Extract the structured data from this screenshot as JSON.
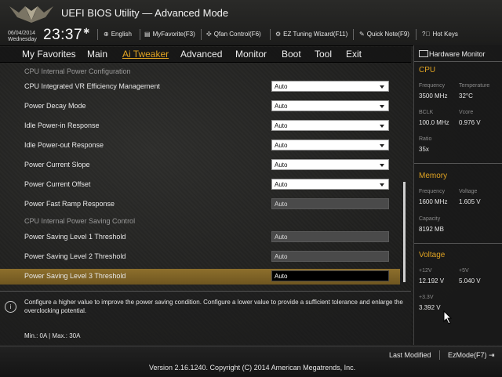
{
  "header": {
    "title": "UEFI BIOS Utility — Advanced Mode",
    "date": "06/04/2014",
    "weekday": "Wednesday",
    "time": "23:37",
    "toolbar": [
      {
        "icon": "globe-icon",
        "label": "English"
      },
      {
        "icon": "favorite-icon",
        "label": "MyFavorite(F3)"
      },
      {
        "icon": "fan-icon",
        "label": "Qfan Control(F6)"
      },
      {
        "icon": "wizard-icon",
        "label": "EZ Tuning Wizard(F11)"
      },
      {
        "icon": "note-icon",
        "label": "Quick Note(F9)"
      },
      {
        "icon": "help-icon",
        "label": "Hot Keys"
      }
    ]
  },
  "menu": {
    "items": [
      "My Favorites",
      "Main",
      "Ai Tweaker",
      "Advanced",
      "Monitor",
      "Boot",
      "Tool",
      "Exit"
    ],
    "active": "Ai Tweaker"
  },
  "settings": [
    {
      "label": "CPU Internal Power Configuration",
      "type": "group"
    },
    {
      "label": "CPU Integrated VR Efficiency Management",
      "value": "Auto",
      "control": "dropdown"
    },
    {
      "label": "Power Decay Mode",
      "value": "Auto",
      "control": "dropdown"
    },
    {
      "label": "Idle Power-in Response",
      "value": "Auto",
      "control": "dropdown"
    },
    {
      "label": "Idle Power-out Response",
      "value": "Auto",
      "control": "dropdown"
    },
    {
      "label": "Power Current Slope",
      "value": "Auto",
      "control": "dropdown"
    },
    {
      "label": "Power Current Offset",
      "value": "Auto",
      "control": "dropdown"
    },
    {
      "label": "Power Fast Ramp Response",
      "value": "Auto",
      "control": "field"
    },
    {
      "label": "CPU Internal Power Saving Control",
      "type": "group"
    },
    {
      "label": "Power Saving Level 1 Threshold",
      "value": "Auto",
      "control": "field"
    },
    {
      "label": "Power Saving Level 2 Threshold",
      "value": "Auto",
      "control": "field"
    },
    {
      "label": "Power Saving Level 3 Threshold",
      "value": "Auto",
      "control": "field",
      "selected": true
    }
  ],
  "help": {
    "text": "Configure a higher value to improve the power saving condition. Configure a lower value to provide a sufficient tolerance and enlarge the overclocking potential.",
    "range": "Min.: 0A   |   Max.: 30A"
  },
  "hardware_monitor": {
    "title": "Hardware Monitor",
    "cpu": {
      "heading": "CPU",
      "frequency_label": "Frequency",
      "frequency": "3500 MHz",
      "temperature_label": "Temperature",
      "temperature": "32°C",
      "bclk_label": "BCLK",
      "bclk": "100.0 MHz",
      "vcore_label": "Vcore",
      "vcore": "0.976 V",
      "ratio_label": "Ratio",
      "ratio": "35x"
    },
    "memory": {
      "heading": "Memory",
      "frequency_label": "Frequency",
      "frequency": "1600 MHz",
      "voltage_label": "Voltage",
      "voltage": "1.605 V",
      "capacity_label": "Capacity",
      "capacity": "8192 MB"
    },
    "voltage": {
      "heading": "Voltage",
      "v12_label": "+12V",
      "v12": "12.192 V",
      "v5_label": "+5V",
      "v5": "5.040 V",
      "v33_label": "+3.3V",
      "v33": "3.392 V"
    }
  },
  "footer": {
    "last_modified": "Last Modified",
    "ezmode": "EzMode(F7)",
    "version": "Version 2.16.1240. Copyright (C) 2014 American Megatrends, Inc."
  },
  "colors": {
    "accent": "#e0a322",
    "selected_row": "#8d6f2c"
  }
}
